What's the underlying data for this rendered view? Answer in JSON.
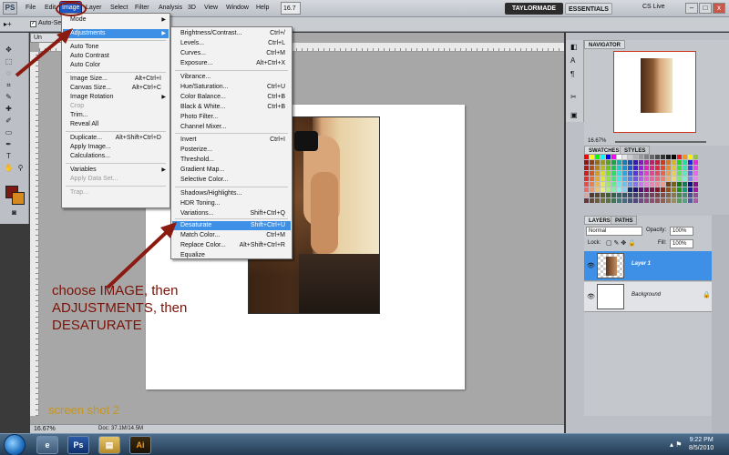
{
  "menubar": {
    "app_logo": "PS",
    "items": [
      {
        "label": "File"
      },
      {
        "label": "Edit"
      },
      {
        "label": "Image"
      },
      {
        "label": "Layer"
      },
      {
        "label": "Select"
      },
      {
        "label": "Filter"
      },
      {
        "label": "Analysis"
      },
      {
        "label": "3D"
      },
      {
        "label": "View"
      },
      {
        "label": "Window"
      },
      {
        "label": "Help"
      }
    ],
    "zoom_select": "16.7",
    "workspace_active": "TAYLORMADE",
    "workspace_essentials": "ESSENTIALS",
    "cs_live": "CS Live",
    "win_minimize": "–",
    "win_maximize": "□",
    "win_close": "x"
  },
  "options_bar": {
    "auto_select_check": "✓",
    "auto_select_label": "Auto-Se"
  },
  "document": {
    "tab_label": "Un",
    "zoom": "16.67%",
    "doc_info": "Doc: 37.1M/14.5M"
  },
  "image_menu": {
    "items": [
      {
        "label": "Mode",
        "shortcut": "",
        "submenu": true,
        "disabled": false
      },
      {
        "label": "Adjustments",
        "shortcut": "",
        "submenu": true,
        "disabled": false,
        "highlighted": true
      },
      {
        "label": "Auto Tone",
        "shortcut": "",
        "disabled": false
      },
      {
        "label": "Auto Contrast",
        "shortcut": "",
        "disabled": false
      },
      {
        "label": "Auto Color",
        "shortcut": "",
        "disabled": false
      },
      {
        "label": "Image Size...",
        "shortcut": "Alt+Ctrl+I",
        "disabled": false
      },
      {
        "label": "Canvas Size...",
        "shortcut": "Alt+Ctrl+C",
        "disabled": false
      },
      {
        "label": "Image Rotation",
        "shortcut": "",
        "submenu": true,
        "disabled": false
      },
      {
        "label": "Crop",
        "shortcut": "",
        "disabled": true
      },
      {
        "label": "Trim...",
        "shortcut": "",
        "disabled": false
      },
      {
        "label": "Reveal All",
        "shortcut": "",
        "disabled": false
      },
      {
        "label": "Duplicate...",
        "shortcut": "Alt+Shift+Ctrl+D",
        "disabled": false
      },
      {
        "label": "Apply Image...",
        "shortcut": "",
        "disabled": false
      },
      {
        "label": "Calculations...",
        "shortcut": "",
        "disabled": false
      },
      {
        "label": "Variables",
        "shortcut": "",
        "submenu": true,
        "disabled": false
      },
      {
        "label": "Apply Data Set...",
        "shortcut": "",
        "disabled": true
      },
      {
        "label": "Trap...",
        "shortcut": "",
        "disabled": true
      }
    ]
  },
  "adjustments_menu": {
    "items": [
      {
        "label": "Brightness/Contrast...",
        "shortcut": "Ctrl+/"
      },
      {
        "label": "Levels...",
        "shortcut": "Ctrl+L"
      },
      {
        "label": "Curves...",
        "shortcut": "Ctrl+M"
      },
      {
        "label": "Exposure...",
        "shortcut": "Alt+Ctrl+X"
      },
      {
        "label": "Vibrance...",
        "shortcut": ""
      },
      {
        "label": "Hue/Saturation...",
        "shortcut": "Ctrl+U"
      },
      {
        "label": "Color Balance...",
        "shortcut": "Ctrl+B"
      },
      {
        "label": "Black & White...",
        "shortcut": "Ctrl+B"
      },
      {
        "label": "Photo Filter...",
        "shortcut": ""
      },
      {
        "label": "Channel Mixer...",
        "shortcut": ""
      },
      {
        "label": "Invert",
        "shortcut": "Ctrl+I"
      },
      {
        "label": "Posterize...",
        "shortcut": ""
      },
      {
        "label": "Threshold...",
        "shortcut": ""
      },
      {
        "label": "Gradient Map...",
        "shortcut": ""
      },
      {
        "label": "Selective Color...",
        "shortcut": ""
      },
      {
        "label": "Shadows/Highlights...",
        "shortcut": ""
      },
      {
        "label": "HDR Toning...",
        "shortcut": ""
      },
      {
        "label": "Variations...",
        "shortcut": "Shift+Ctrl+Q"
      },
      {
        "label": "Desaturate",
        "shortcut": "Shift+Ctrl+U",
        "highlighted": true
      },
      {
        "label": "Match Color...",
        "shortcut": "Ctrl+M"
      },
      {
        "label": "Replace Color...",
        "shortcut": "Alt+Shift+Ctrl+R"
      },
      {
        "label": "Equalize",
        "shortcut": ""
      }
    ]
  },
  "navigator": {
    "tab": "NAVIGATOR",
    "zoom": "16.67%"
  },
  "swatches": {
    "tab": "SWATCHES",
    "tab2": "STYLES"
  },
  "layers": {
    "tab": "LAYERS",
    "tab2": "PATHS",
    "blend_mode": "Normal",
    "opacity_label": "Opacity:",
    "opacity_value": "100%",
    "lock_label": "Lock:",
    "fill_label": "Fill:",
    "fill_value": "100%",
    "rows": [
      {
        "name": "Layer 1",
        "selected": true
      },
      {
        "name": "Background",
        "selected": false
      }
    ]
  },
  "annotation": {
    "lines": [
      "choose IMAGE, then",
      "ADJUSTMENTS, then",
      "DESATURATE"
    ],
    "label": "screen shot 2"
  },
  "taskbar": {
    "ps_label": "Ps",
    "ai_label": "Ai",
    "time": "9:22 PM",
    "date": "8/5/2010"
  },
  "colors": {
    "foreground": "#7b1a12",
    "background": "#d6891e",
    "menu_highlight": "#3e8fe6",
    "annotation_text": "#7a1208",
    "label_text": "#c8951c"
  }
}
